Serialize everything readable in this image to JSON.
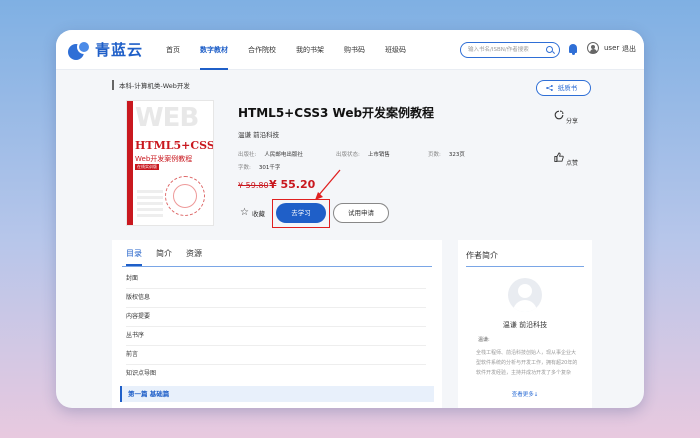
{
  "nav": {
    "logo_text": "青蓝云",
    "menu": [
      "首页",
      "数字教材",
      "合作院校",
      "我的书架",
      "购书码",
      "班级码"
    ],
    "active_index": 1,
    "search_placeholder": "输入书名/ISBN/作者搜索",
    "user_name": "user",
    "logout": "退出"
  },
  "breadcrumb": "本科-计算机类-Web开发",
  "paper_book": "纸质书",
  "cover": {
    "web_text": "WEB",
    "title_line1": "HTML5+CSS3",
    "title_line2": "Web开发案例教程",
    "badge": "在线实训版"
  },
  "book": {
    "title": "HTML5+CSS3 Web开发案例教程",
    "author": "温谦 前沿科技",
    "publisher_label": "出版社:",
    "publisher": "人民邮电出版社",
    "status_label": "出版状态:",
    "status": "上市销售",
    "pages_label": "页数:",
    "pages": "323页",
    "words_label": "字数:",
    "words": "301千字",
    "price_old": "¥ 59.80",
    "price_new": "¥ 55.20"
  },
  "actions": {
    "favorite": "收藏",
    "study": "去学习",
    "trial": "试用申请",
    "share": "分享",
    "like": "点赞"
  },
  "tabs": [
    "目录",
    "简介",
    "资源"
  ],
  "toc": [
    "封面",
    "版权信息",
    "内容提要",
    "丛书序",
    "前言",
    "知识点导图"
  ],
  "toc_part": "第一篇 基础篇",
  "author_panel": {
    "title": "作者简介",
    "name": "温谦 前沿科技",
    "label": "温谦:",
    "desc": "全栈工程师、前沿科技创始人，现从事企业大型软件系统的分析与开发工作，拥有超20年的软件开发经验，主持并成功开发了多个复杂",
    "more": "查看更多↓"
  },
  "colors": {
    "accent": "#1f5fc8",
    "price": "#c9181f",
    "highlight": "#e02020"
  }
}
